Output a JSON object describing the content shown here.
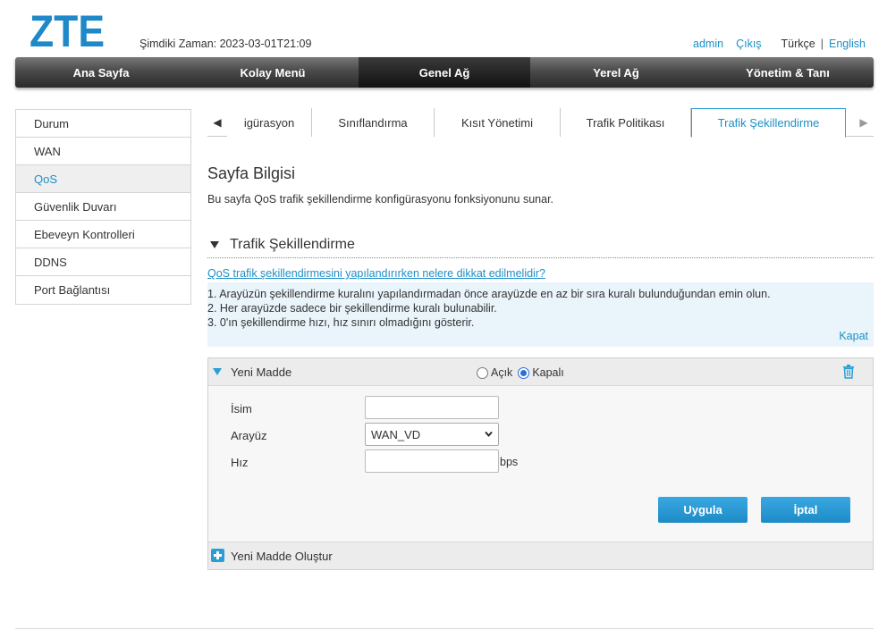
{
  "brand": {
    "logo_text": "ZTE",
    "color": "#1e88c8"
  },
  "header": {
    "time_label": "Şimdiki Zaman: 2023-03-01T21:09",
    "user": "admin",
    "logout": "Çıkış",
    "lang_current": "Türkçe",
    "lang_other": "English"
  },
  "main_nav": [
    {
      "label": "Ana Sayfa"
    },
    {
      "label": "Kolay Menü"
    },
    {
      "label": "Genel Ağ",
      "active": true
    },
    {
      "label": "Yerel Ağ"
    },
    {
      "label": "Yönetim & Tanı"
    }
  ],
  "sidebar": {
    "items": [
      {
        "label": "Durum"
      },
      {
        "label": "WAN"
      },
      {
        "label": "QoS",
        "active": true
      },
      {
        "label": "Güvenlik Duvarı"
      },
      {
        "label": "Ebeveyn Kontrolleri"
      },
      {
        "label": "DDNS"
      },
      {
        "label": "Port Bağlantısı"
      }
    ]
  },
  "subtabs": [
    {
      "label": "igürasyon"
    },
    {
      "label": "Sınıflandırma"
    },
    {
      "label": "Kısıt Yönetimi"
    },
    {
      "label": "Trafik Politikası"
    },
    {
      "label": "Trafik Şekillendirme",
      "active": true
    }
  ],
  "page": {
    "title": "Sayfa Bilgisi",
    "description": "Bu sayfa QoS trafik şekillendirme konfigürasyonu fonksiyonunu sunar."
  },
  "section": {
    "title": "Trafik Şekillendirme",
    "help_link": "QoS trafik şekillendirmesini yapılandırırken nelere dikkat edilmelidir?",
    "help_lines": [
      "1. Arayüzün şekillendirme kuralını yapılandırmadan önce arayüzde en az bir sıra kuralı bulunduğundan emin olun.",
      "2. Her arayüzde sadece bir şekillendirme kuralı bulunabilir.",
      "3. 0'ın şekillendirme hızı, hız sınırı olmadığını gösterir."
    ],
    "help_close": "Kapat"
  },
  "item": {
    "title": "Yeni Madde",
    "radio_on": "Açık",
    "radio_off": "Kapalı",
    "selected": "Kapalı",
    "fields": {
      "name_label": "İsim",
      "name_value": "",
      "interface_label": "Arayüz",
      "interface_value": "WAN_VD",
      "rate_label": "Hız",
      "rate_value": "",
      "rate_unit": "bps"
    },
    "apply": "Uygula",
    "cancel": "İptal",
    "create_new": "Yeni Madde Oluştur"
  }
}
